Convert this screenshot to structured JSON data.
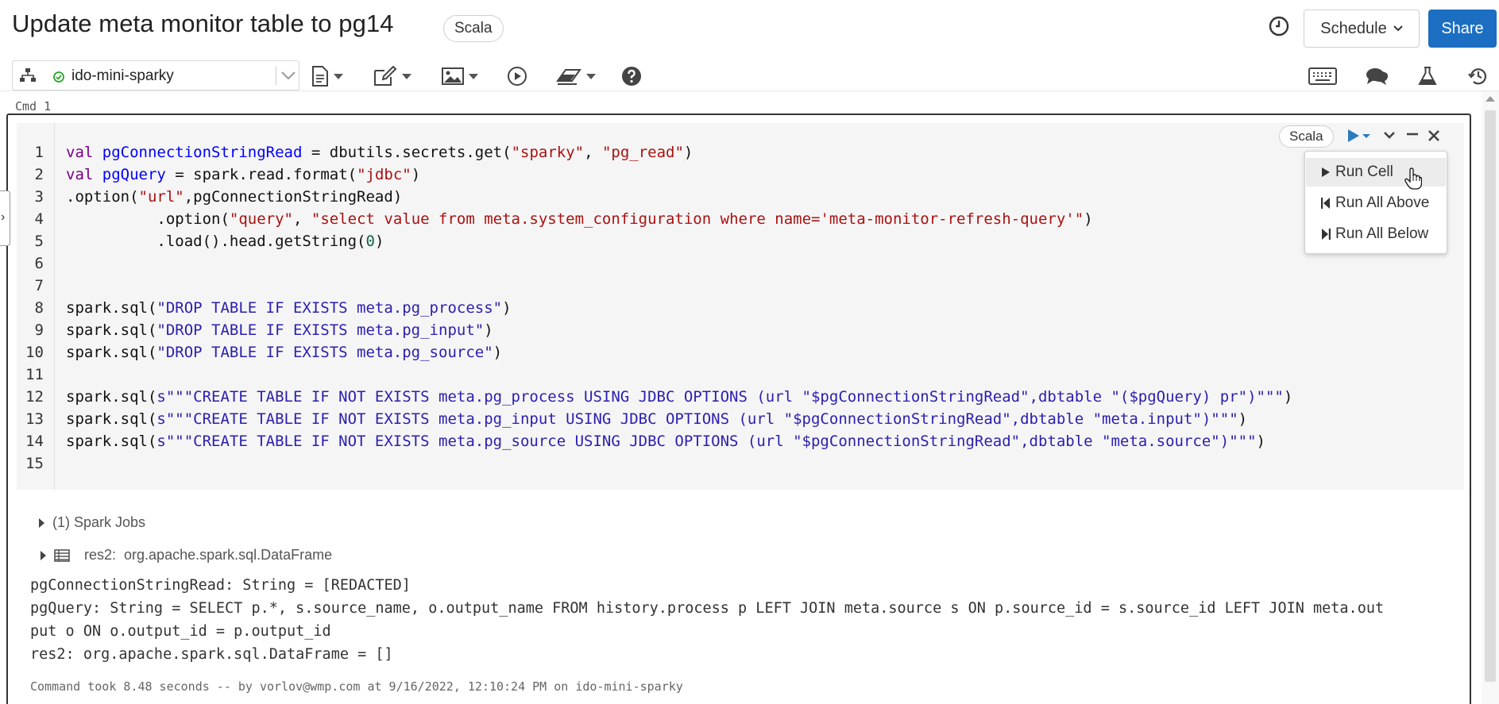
{
  "header": {
    "title": "Update meta monitor table to pg14",
    "language_badge": "Scala",
    "schedule_label": "Schedule",
    "share_label": "Share"
  },
  "toolbar": {
    "cluster_name": "ido-mini-sparky",
    "icons": [
      "cluster-tree-icon",
      "file-menu-icon",
      "edit-menu-icon",
      "view-menu-icon",
      "run-all-icon",
      "clear-menu-icon",
      "help-icon",
      "keyboard-shortcuts-icon",
      "comments-icon",
      "experiment-icon",
      "revision-history-icon"
    ]
  },
  "cell": {
    "cmd_label": "Cmd 1",
    "language_label": "Scala",
    "line_numbers": [
      "1",
      "2",
      "3",
      "4",
      "5",
      "6",
      "7",
      "8",
      "9",
      "10",
      "11",
      "12",
      "13",
      "14",
      "15"
    ],
    "code": {
      "l1": [
        "val",
        "pgConnectionStringRead",
        " = dbutils.secrets.get(",
        "\"sparky\"",
        ", ",
        "\"pg_read\"",
        ")"
      ],
      "l2": [
        "val",
        "pgQuery",
        " = spark.read.format(",
        "\"jdbc\"",
        ")"
      ],
      "l3": [
        ".option(",
        "\"url\"",
        ",pgConnectionStringRead)"
      ],
      "l4": [
        "          .option(",
        "\"query\"",
        ", ",
        "\"select value from meta.system_configuration where name='meta-monitor-refresh-query'\"",
        ")"
      ],
      "l5": [
        "          .load().head.getString(",
        "0",
        ")"
      ],
      "l8": [
        "spark.sql(",
        "\"DROP TABLE IF EXISTS meta.pg_process\"",
        ")"
      ],
      "l9": [
        "spark.sql(",
        "\"DROP TABLE IF EXISTS meta.pg_input\"",
        ")"
      ],
      "l10": [
        "spark.sql(",
        "\"DROP TABLE IF EXISTS meta.pg_source\"",
        ")"
      ],
      "l12": [
        "spark.sql(",
        "s\"\"\"CREATE TABLE IF NOT EXISTS meta.pg_process USING JDBC OPTIONS (url \"$pgConnectionStringRead\",dbtable \"($pgQuery) pr\")\"\"\"",
        ")"
      ],
      "l13": [
        "spark.sql(",
        "s\"\"\"CREATE TABLE IF NOT EXISTS meta.pg_input USING JDBC OPTIONS (url \"$pgConnectionStringRead\",dbtable \"meta.input\")\"\"\"",
        ")"
      ],
      "l14": [
        "spark.sql(",
        "s\"\"\"CREATE TABLE IF NOT EXISTS meta.pg_source USING JDBC OPTIONS (url \"$pgConnectionStringRead\",dbtable \"meta.source\")\"\"\"",
        ")"
      ]
    },
    "run_menu": {
      "items": [
        "Run Cell",
        "Run All Above",
        "Run All Below"
      ]
    }
  },
  "output": {
    "spark_jobs": "(1) Spark Jobs",
    "result_name": "res2:",
    "result_type": "org.apache.spark.sql.DataFrame",
    "lines": [
      "pgConnectionStringRead: String = [REDACTED]",
      "pgQuery: String = SELECT p.*, s.source_name, o.output_name FROM history.process p LEFT JOIN meta.source s ON p.source_id = s.source_id LEFT JOIN meta.out",
      "put o ON o.output_id = p.output_id",
      "res2: org.apache.spark.sql.DataFrame = []"
    ],
    "command_took": "Command took 8.48 seconds -- by vorlov@wmp.com at 9/16/2022, 12:10:24 PM on ido-mini-sparky"
  },
  "colors": {
    "share_bg": "#1b6ec2",
    "keyword": "#770088",
    "variable": "#0000ff",
    "string": "#aa1111",
    "number": "#116644",
    "cluster_running": "#2aa52a"
  }
}
